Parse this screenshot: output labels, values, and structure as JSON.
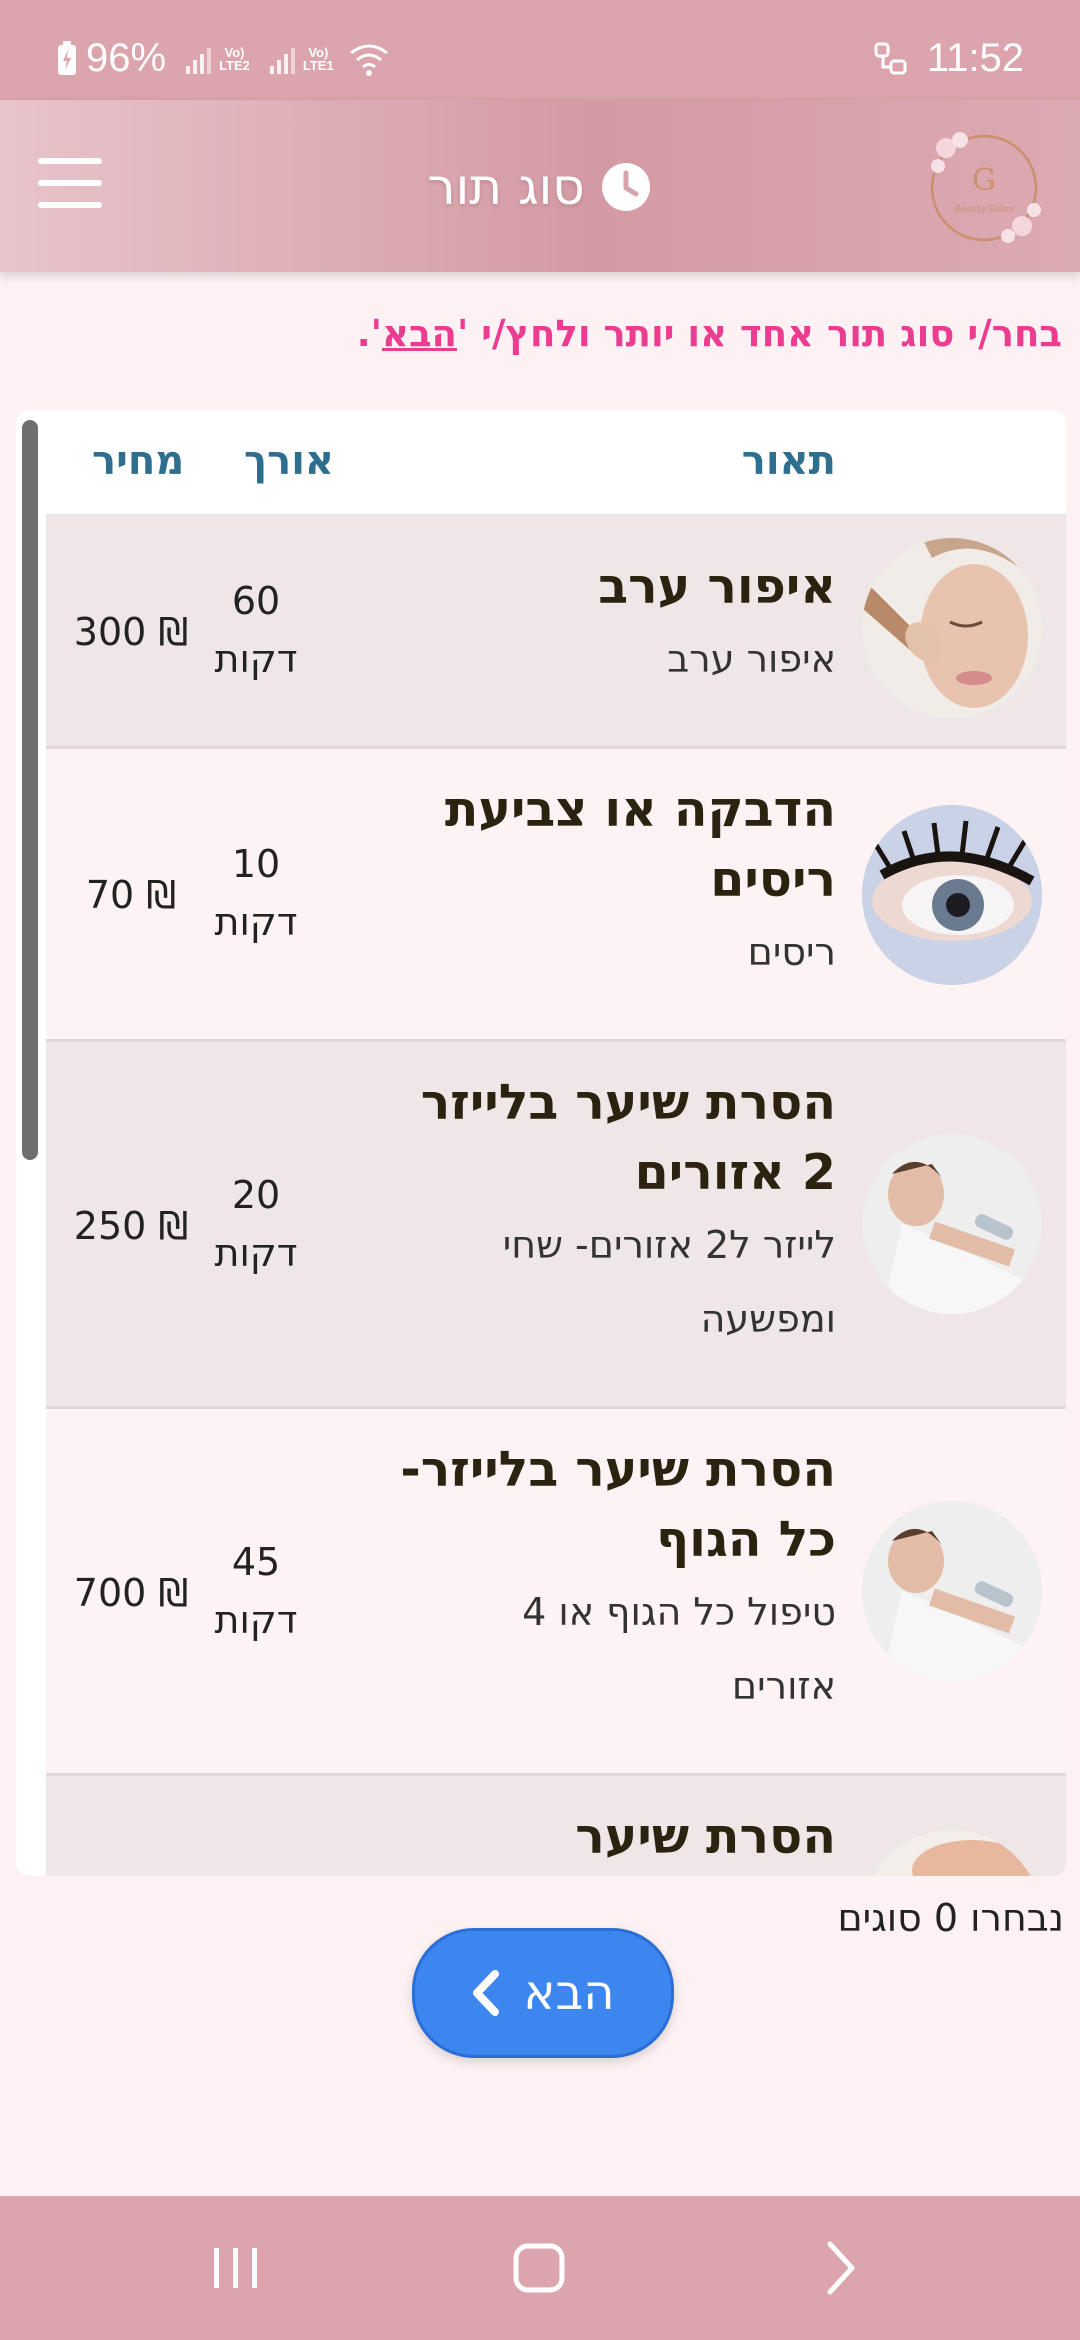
{
  "status_bar": {
    "battery": "96%",
    "sim1": "LTE2",
    "sim2": "LTE1",
    "time": "11:52"
  },
  "header": {
    "title": "סוג תור",
    "logo_text": "Beauty Salon"
  },
  "instruction": {
    "before": "בחר/י סוג תור אחד או יותר ולחץ/י '",
    "link": "הבא",
    "after": "'."
  },
  "table": {
    "columns": {
      "description": "תאור",
      "length": "אורך",
      "price": "מחיר"
    },
    "rows": [
      {
        "name_lines": [
          "איפור ערב"
        ],
        "desc_lines": [
          "איפור ערב"
        ],
        "length_value": "60",
        "length_unit": "דקות",
        "price": "300 ₪",
        "image": "makeup-brush-face"
      },
      {
        "name_lines": [
          "הדבקה או צביעת",
          "ריסים"
        ],
        "desc_lines": [
          "ריסים"
        ],
        "length_value": "10",
        "length_unit": "דקות",
        "price": "70 ₪",
        "image": "eyelashes-closeup"
      },
      {
        "name_lines": [
          "הסרת שיער בלייזר",
          "2 אזורים"
        ],
        "desc_lines": [
          "לייזר ל2 אזורים- שחי",
          "ומפשעה"
        ],
        "length_value": "20",
        "length_unit": "דקות",
        "price": "250 ₪",
        "image": "laser-treatment"
      },
      {
        "name_lines": [
          "הסרת שיער בלייזר-",
          "כל הגוף"
        ],
        "desc_lines": [
          "טיפול כל הגוף או 4",
          "אזורים"
        ],
        "length_value": "45",
        "length_unit": "דקות",
        "price": "700 ₪",
        "image": "laser-treatment"
      },
      {
        "name_lines": [
          "הסרת שיער"
        ],
        "desc_lines": [],
        "length_value": "",
        "length_unit": "",
        "price": "",
        "image": "treatment-partial"
      }
    ]
  },
  "selection": {
    "text": "נבחרו 0 סוגים"
  },
  "next_button": {
    "label": "הבא"
  },
  "colors": {
    "status_bar": "#dca4ac",
    "accent_pink": "#ec3c8f",
    "column_header": "#2e6e8e",
    "button_blue": "#3d86f0"
  }
}
